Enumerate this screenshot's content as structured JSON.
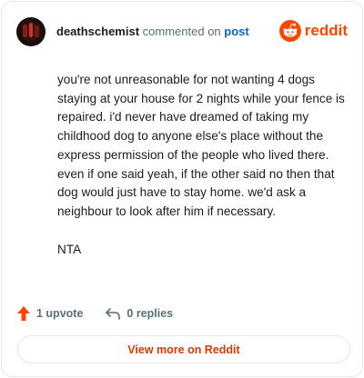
{
  "comment": {
    "username": "deathschemist",
    "action_text": "commented on",
    "post_link_label": "post",
    "paragraphs": [
      "you're not unreasonable for not wanting 4 dogs staying at your house for 2 nights while your fence is repaired. i'd never have dreamed of taking my childhood dog to anyone else's place without the express permission of the people who lived there. even if one said yeah, if the other said no then that dog would just have to stay home. we'd ask a neighbour to look after him if necessary.",
      "NTA"
    ]
  },
  "brand": {
    "name": "reddit",
    "color": "#ff4500",
    "icon": "reddit-alien-icon"
  },
  "actions": {
    "upvote_label": "1 upvote",
    "replies_label": "0 replies",
    "upvote_icon": "upvote-arrow-icon",
    "reply_icon": "reply-arrow-icon",
    "upvote_color": "#ff4500"
  },
  "footer": {
    "view_more_label": "View more on Reddit",
    "accent": "#d93a00"
  }
}
